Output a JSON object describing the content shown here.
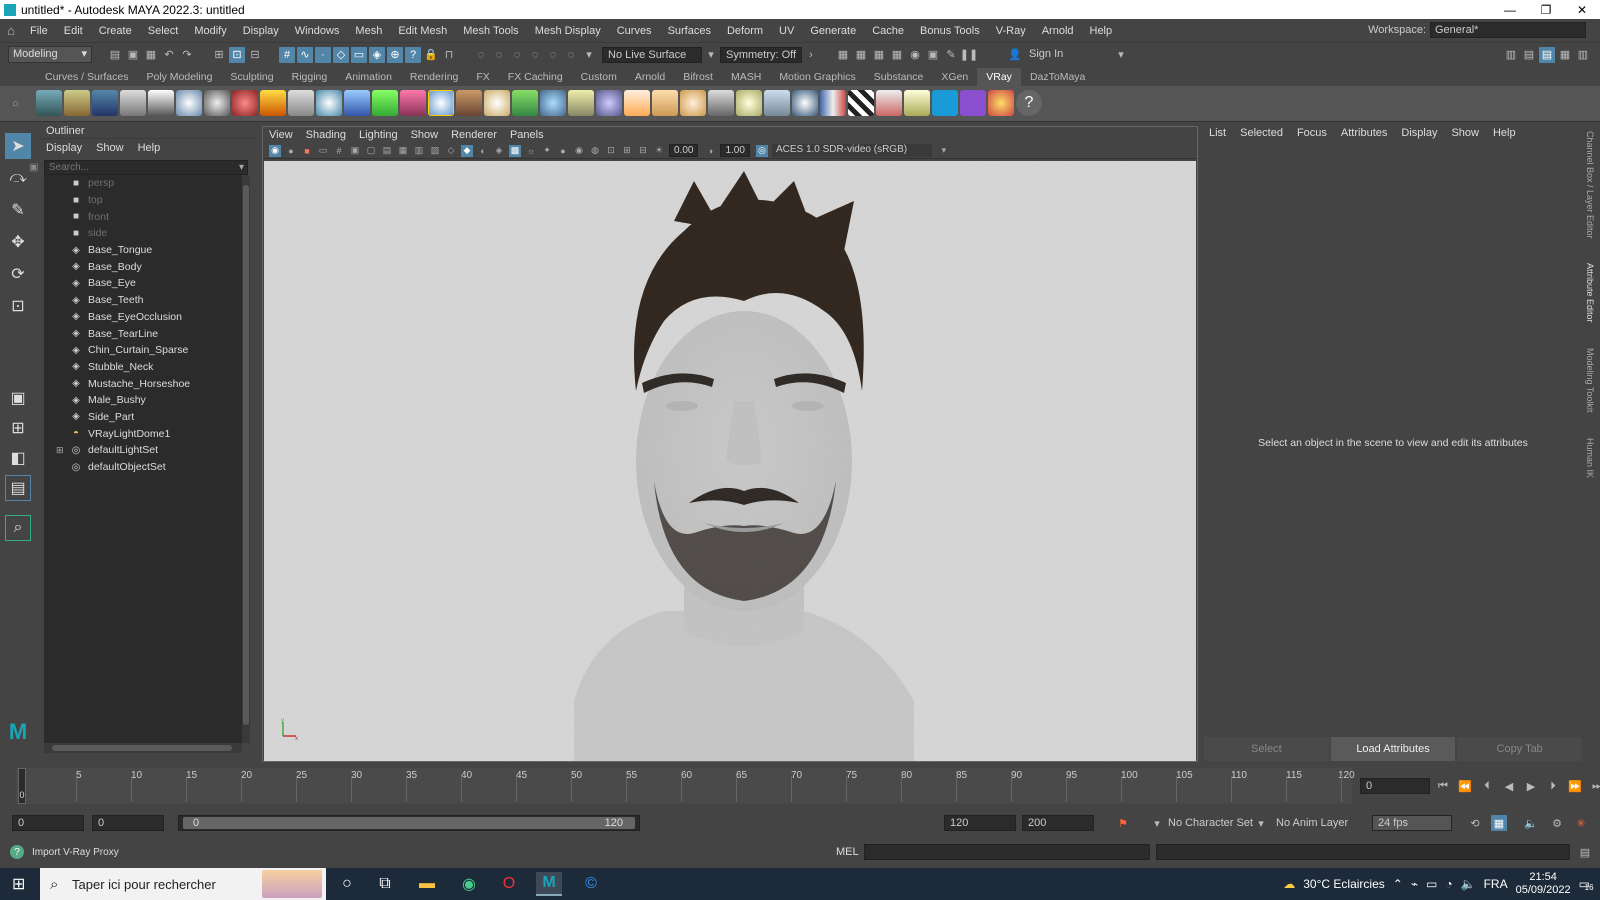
{
  "title": "untitled* - Autodesk MAYA 2022.3: untitled",
  "window_controls": [
    "—",
    "❐",
    "✕"
  ],
  "menus": [
    "File",
    "Edit",
    "Create",
    "Select",
    "Modify",
    "Display",
    "Windows",
    "Mesh",
    "Edit Mesh",
    "Mesh Tools",
    "Mesh Display",
    "Curves",
    "Surfaces",
    "Deform",
    "UV",
    "Generate",
    "Cache",
    "Bonus Tools",
    "V-Ray",
    "Arnold",
    "Help"
  ],
  "workspace": {
    "label": "Workspace:",
    "value": "General*"
  },
  "statusline": {
    "mode": "Modeling",
    "live_surface": "No Live Surface",
    "symmetry": "Symmetry: Off",
    "sign_in": "Sign In"
  },
  "shelf_tabs": [
    "Curves / Surfaces",
    "Poly Modeling",
    "Sculpting",
    "Rigging",
    "Animation",
    "Rendering",
    "FX",
    "FX Caching",
    "Custom",
    "Arnold",
    "Bifrost",
    "MASH",
    "Motion Graphics",
    "Substance",
    "XGen",
    "VRay",
    "DazToMaya"
  ],
  "shelf_active": "VRay",
  "outliner": {
    "title": "Outliner",
    "menu": [
      "Display",
      "Show",
      "Help"
    ],
    "search_placeholder": "Search...",
    "items": [
      {
        "label": "persp",
        "icon": "camera-icon",
        "dim": true
      },
      {
        "label": "top",
        "icon": "camera-icon",
        "dim": true
      },
      {
        "label": "front",
        "icon": "camera-icon",
        "dim": true
      },
      {
        "label": "side",
        "icon": "camera-icon",
        "dim": true
      },
      {
        "label": "Base_Tongue",
        "icon": "mesh-icon",
        "dim": false
      },
      {
        "label": "Base_Body",
        "icon": "mesh-icon",
        "dim": false
      },
      {
        "label": "Base_Eye",
        "icon": "mesh-icon",
        "dim": false
      },
      {
        "label": "Base_Teeth",
        "icon": "mesh-icon",
        "dim": false
      },
      {
        "label": "Base_EyeOcclusion",
        "icon": "mesh-icon",
        "dim": false
      },
      {
        "label": "Base_TearLine",
        "icon": "mesh-icon",
        "dim": false
      },
      {
        "label": "Chin_Curtain_Sparse",
        "icon": "mesh-icon",
        "dim": false
      },
      {
        "label": "Stubble_Neck",
        "icon": "mesh-icon",
        "dim": false
      },
      {
        "label": "Mustache_Horseshoe",
        "icon": "mesh-icon",
        "dim": false
      },
      {
        "label": "Male_Bushy",
        "icon": "mesh-icon",
        "dim": false
      },
      {
        "label": "Side_Part",
        "icon": "mesh-icon",
        "dim": false
      },
      {
        "label": "VRayLightDome1",
        "icon": "dome-light-icon",
        "dim": false
      },
      {
        "label": "defaultLightSet",
        "icon": "set-icon",
        "dim": false
      },
      {
        "label": "defaultObjectSet",
        "icon": "set-icon",
        "dim": false
      }
    ]
  },
  "viewport": {
    "menu": [
      "View",
      "Shading",
      "Lighting",
      "Show",
      "Renderer",
      "Panels"
    ],
    "exposure": "0.00",
    "gamma": "1.00",
    "color_space": "ACES 1.0 SDR-video (sRGB)"
  },
  "attribute_editor": {
    "menu": [
      "List",
      "Selected",
      "Focus",
      "Attributes",
      "Display",
      "Show",
      "Help"
    ],
    "message": "Select an object in the scene to view and edit its attributes",
    "buttons": [
      "Select",
      "Load Attributes",
      "Copy Tab"
    ]
  },
  "side_tabs": [
    "Channel Box / Layer Editor",
    "Attribute Editor",
    "Modeling Toolkit",
    "Human IK"
  ],
  "timeline": {
    "ticks": [
      "5",
      "10",
      "15",
      "20",
      "25",
      "30",
      "35",
      "40",
      "45",
      "50",
      "55",
      "60",
      "65",
      "70",
      "75",
      "80",
      "85",
      "90",
      "95",
      "100",
      "105",
      "110",
      "115",
      "120"
    ],
    "current_frame": "0",
    "current_display": "0"
  },
  "range": {
    "start": "0",
    "anim_start": "0",
    "slider_start": "0",
    "slider_end": "120",
    "end": "120",
    "anim_end": "200",
    "character_set": "No Character Set",
    "anim_layer": "No Anim Layer",
    "fps": "24 fps"
  },
  "command": {
    "help_text": "Import V-Ray Proxy",
    "lang": "MEL"
  },
  "taskbar": {
    "search_placeholder": "Taper ici pour rechercher",
    "weather": "30°C Eclaircies",
    "lang": "FRA",
    "time": "21:54",
    "date": "05/09/2022",
    "notifications": "16"
  }
}
